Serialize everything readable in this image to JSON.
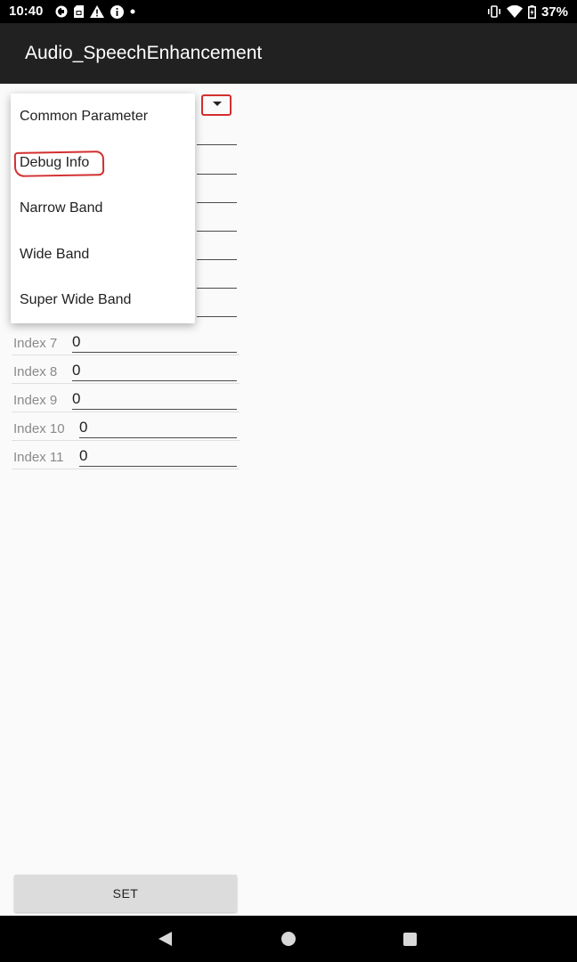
{
  "status_bar": {
    "time": "10:40",
    "battery_percent": "37%",
    "left_icons": [
      "sync-icon",
      "sim-card-icon",
      "warning-icon",
      "info-icon",
      "dot-icon"
    ],
    "right_icons": [
      "vibrate-icon",
      "wifi-icon",
      "battery-icon"
    ]
  },
  "app_bar": {
    "title": "Audio_SpeechEnhancement"
  },
  "dropdown": {
    "items": [
      {
        "label": "Common Parameter"
      },
      {
        "label": "Debug Info"
      },
      {
        "label": "Narrow Band"
      },
      {
        "label": "Wide Band"
      },
      {
        "label": "Super Wide Band"
      }
    ],
    "highlighted_item": "Debug Info",
    "annotation_color": "#d32f2f"
  },
  "rows": [
    {
      "label": "Index 7",
      "value": "0"
    },
    {
      "label": "Index 8",
      "value": "0"
    },
    {
      "label": "Index 9",
      "value": "0"
    },
    {
      "label": "Index 10",
      "value": "0"
    },
    {
      "label": "Index 11",
      "value": "0"
    }
  ],
  "set_button": {
    "label": "SET"
  },
  "nav_bar": {
    "icons": [
      "back-icon",
      "home-icon",
      "recents-icon"
    ]
  }
}
